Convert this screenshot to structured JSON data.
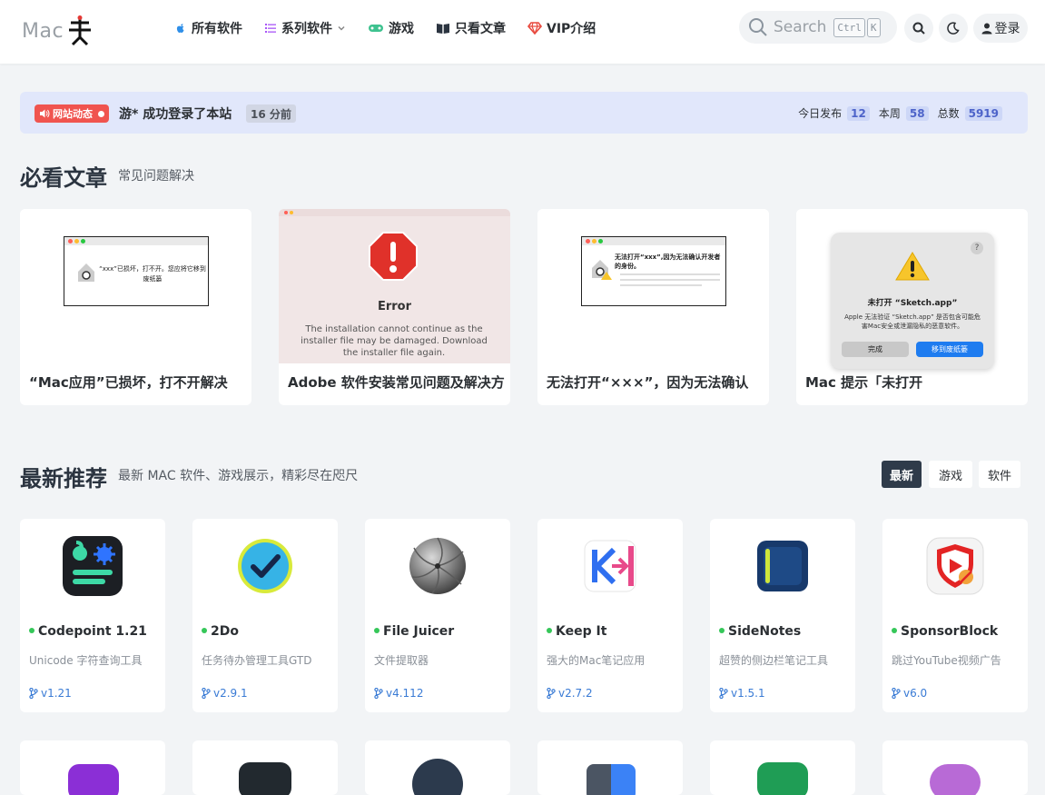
{
  "header": {
    "logo_text": "Mac",
    "nav": [
      {
        "label": "所有软件",
        "icon": "apple-icon"
      },
      {
        "label": "系列软件",
        "icon": "list-icon"
      },
      {
        "label": "游戏",
        "icon": "gamepad-icon"
      },
      {
        "label": "只看文章",
        "icon": "book-icon"
      },
      {
        "label": "VIP介绍",
        "icon": "gem-icon"
      }
    ],
    "search_placeholder": "Search",
    "kbd_ctrl": "Ctrl",
    "kbd_k": "K",
    "login_label": "登录"
  },
  "announcement": {
    "badge": "网站动态",
    "text": "游* 成功登录了本站",
    "time": "16 分前",
    "today_label": "今日发布",
    "today_value": "12",
    "week_label": "本周",
    "week_value": "58",
    "total_label": "总数",
    "total_value": "5919"
  },
  "must_read": {
    "title": "必看文章",
    "subtitle": "常见问题解决",
    "cards": [
      {
        "title": "“Mac应用”已损坏，打不开解决",
        "thumb_text": "“xxx”已损坏，打不开。您应将它移到废纸篓"
      },
      {
        "title": "Adobe 软件安装常见问题及解决方",
        "thumb_heading": "Error",
        "thumb_text": "The installation cannot continue as the installer file may be damaged. Download the installer file again."
      },
      {
        "title": "无法打开“×××”，因为无法确认",
        "thumb_text": "无法打开“xxx”,因为无法确认开发者的身份。"
      },
      {
        "title": "Mac 提示「未打开",
        "thumb_heading": "未打开 “Sketch.app”",
        "thumb_text": "Apple 无法验证 “Sketch.app” 是否包含可能危害Mac安全或泄漏隐私的恶意软件。",
        "thumb_btn_done": "完成",
        "thumb_btn_trash": "移到废纸篓"
      }
    ]
  },
  "latest": {
    "title": "最新推荐",
    "subtitle": "最新 MAC 软件、游戏展示，精彩尽在咫尺",
    "tabs": [
      "最新",
      "游戏",
      "软件"
    ],
    "apps": [
      {
        "name": "Codepoint 1.21",
        "desc": "Unicode 字符查询工具",
        "version": "v1.21",
        "icon": "codepoint-app-icon"
      },
      {
        "name": "2Do",
        "desc": "任务待办管理工具GTD",
        "version": "v2.9.1",
        "icon": "2do-app-icon"
      },
      {
        "name": "File Juicer",
        "desc": "文件提取器",
        "version": "v4.112",
        "icon": "file-juicer-app-icon"
      },
      {
        "name": "Keep It",
        "desc": "强大的Mac笔记应用",
        "version": "v2.7.2",
        "icon": "keep-it-app-icon"
      },
      {
        "name": "SideNotes",
        "desc": "超赞的侧边栏笔记工具",
        "version": "v1.5.1",
        "icon": "sidenotes-app-icon"
      },
      {
        "name": "SponsorBlock",
        "desc": "跳过YouTube视频广告",
        "version": "v6.0",
        "icon": "sponsorblock-app-icon"
      }
    ]
  },
  "colors": {
    "accent": "#2f3b4a",
    "badge_red": "#f0544f",
    "link_blue": "#3a7bd5",
    "online_green": "#35c759"
  }
}
